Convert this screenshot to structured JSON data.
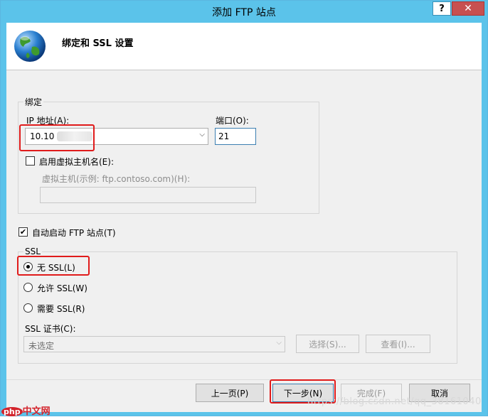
{
  "window": {
    "title": "添加 FTP 站点",
    "help_glyph": "?",
    "close_glyph": "✕"
  },
  "header": {
    "title": "绑定和 SSL 设置"
  },
  "binding": {
    "group_label": "绑定",
    "ip_label": "IP 地址(A):",
    "ip_value": "10.10",
    "port_label": "端口(O):",
    "port_value": "21",
    "virtual_host_checkbox_label": "启用虚拟主机名(E):",
    "virtual_host_checked": false,
    "virtual_host_label": "虚拟主机(示例: ftp.contoso.com)(H):",
    "virtual_host_value": ""
  },
  "auto_start": {
    "label": "自动启动 FTP 站点(T)",
    "checked": true,
    "check_glyph": "✔"
  },
  "ssl": {
    "group_label": "SSL",
    "options": [
      {
        "label": "无 SSL(L)",
        "checked": true
      },
      {
        "label": "允许 SSL(W)",
        "checked": false
      },
      {
        "label": "需要 SSL(R)",
        "checked": false
      }
    ],
    "cert_label": "SSL 证书(C):",
    "cert_value": "未选定",
    "select_button": "选择(S)...",
    "view_button": "查看(I)..."
  },
  "footer": {
    "prev_button": "上一页(P)",
    "next_button": "下一步(N)",
    "finish_button": "完成(F)",
    "cancel_button": "取消"
  },
  "watermark": {
    "text": "https://blog.csdn.net/qq_38161040"
  },
  "logo": {
    "php": "php",
    "cn": "中文网"
  },
  "colors": {
    "title_bar": "#5bc3ea",
    "highlight": "#e01b1b",
    "close_button": "#c75050"
  }
}
